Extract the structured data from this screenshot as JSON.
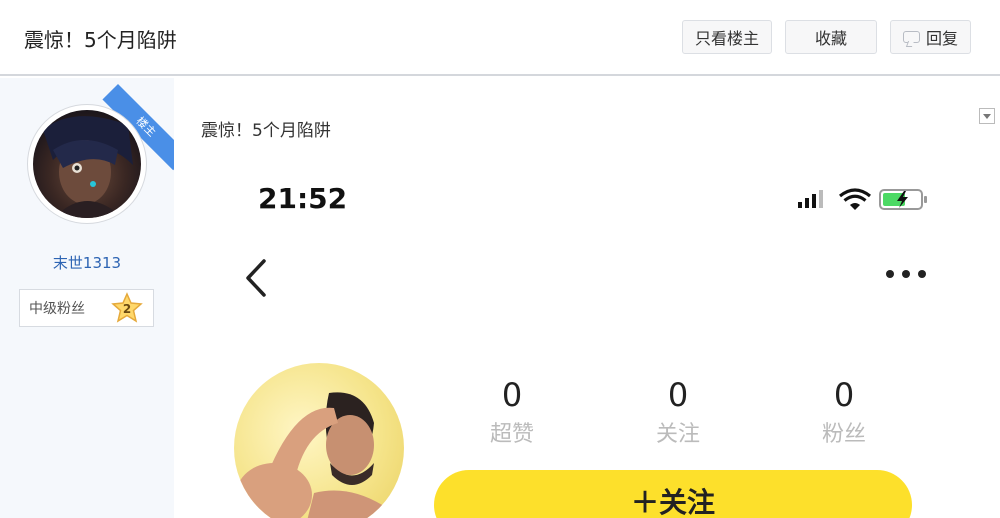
{
  "header": {
    "title": "震惊！5个月陷阱",
    "buttons": {
      "only_op": "只看楼主",
      "favorite": "收藏",
      "reply": "回复"
    }
  },
  "author": {
    "corner_tag": "楼主",
    "username": "末世1313",
    "level_name": "中级粉丝",
    "level_number": "2"
  },
  "post": {
    "title": "震惊！5个月陷阱",
    "screenshot": {
      "time": "21:52",
      "stats": [
        {
          "value": "0",
          "label": "超赞"
        },
        {
          "value": "0",
          "label": "关注"
        },
        {
          "value": "0",
          "label": "粉丝"
        }
      ],
      "follow_label": "＋关注"
    }
  },
  "colors": {
    "accent_blue": "#4a8fe7",
    "username_blue": "#2d64b3",
    "follow_yellow": "#fde02b",
    "battery_green": "#4cd964"
  }
}
